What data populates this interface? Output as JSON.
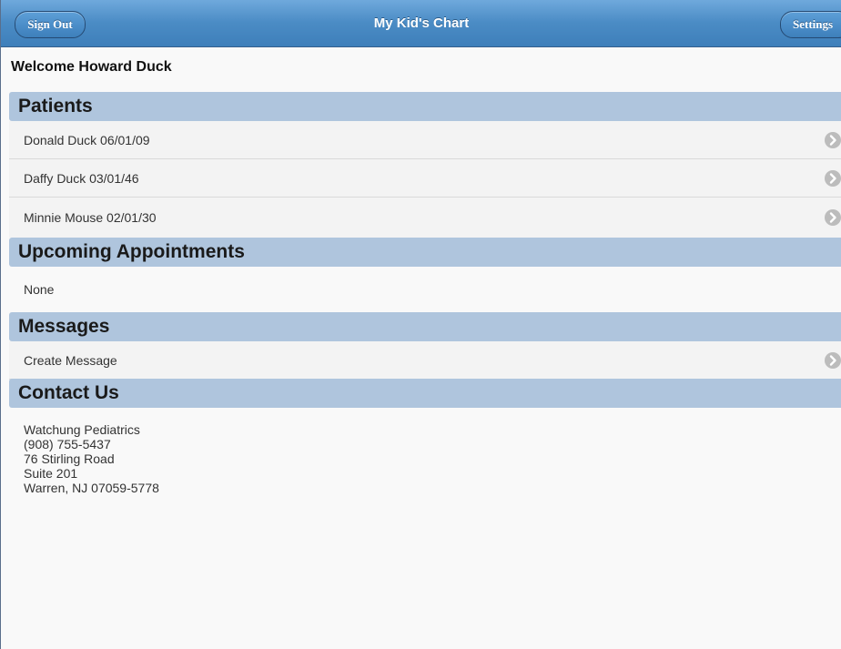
{
  "header": {
    "title": "My Kid's Chart",
    "sign_out_label": "Sign Out",
    "settings_label": "Settings"
  },
  "welcome": "Welcome Howard Duck",
  "patients": {
    "heading": "Patients",
    "items": [
      {
        "label": "Donald Duck 06/01/09"
      },
      {
        "label": "Daffy Duck 03/01/46"
      },
      {
        "label": "Minnie Mouse 02/01/30"
      }
    ]
  },
  "appointments": {
    "heading": "Upcoming Appointments",
    "empty_text": "None"
  },
  "messages": {
    "heading": "Messages",
    "create_label": "Create Message"
  },
  "contact": {
    "heading": "Contact Us",
    "lines": [
      "Watchung Pediatrics",
      "(908) 755-5437",
      "76 Stirling Road",
      "Suite 201",
      "Warren, NJ 07059-5778"
    ]
  },
  "icons": {
    "row_chevron": "chevron-right-icon"
  },
  "colors": {
    "header_blue": "#4b8cc5",
    "section_band": "#afc5dd",
    "page_background": "#f9f9f9"
  }
}
